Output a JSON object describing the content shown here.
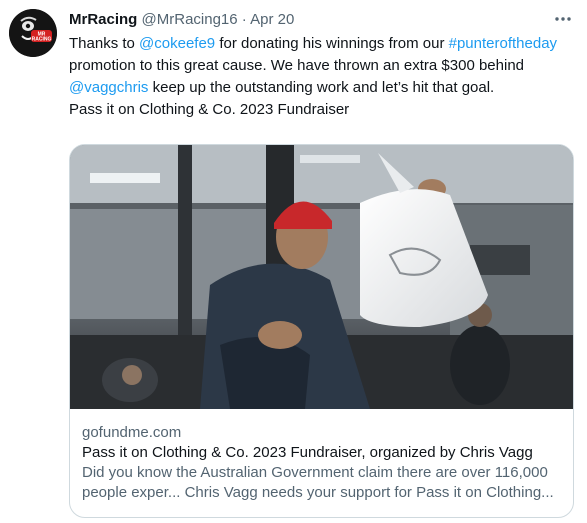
{
  "tweet": {
    "display_name": "MrRacing",
    "handle": "@MrRacing16",
    "separator": "·",
    "date": "Apr 20",
    "more_icon": "more-icon",
    "avatar_text": "MR RACING",
    "body": {
      "p1": "Thanks to ",
      "mention1": "@cokeefe9",
      "p2": " for donating his winnings from our ",
      "hashtag": "#punteroftheday",
      "p3": " promotion to this great cause. We have thrown an extra $300 behind ",
      "mention2": "@vaggchris",
      "p4": " keep up the outstanding work and let’s hit that goal.",
      "line2": "Pass it on Clothing & Co. 2023 Fundraiser"
    },
    "card": {
      "domain": "gofundme.com",
      "title": "Pass it on Clothing & Co. 2023 Fundraiser, organized by Chris Vagg",
      "desc_line1": "Did you know the Australian Government claim there are over 116,000",
      "desc_line2": "people exper... Chris Vagg needs your support for Pass it on Clothing..."
    }
  },
  "colors": {
    "link": "#1d9bf0",
    "secondary": "#536471",
    "border": "#cfd9de"
  }
}
